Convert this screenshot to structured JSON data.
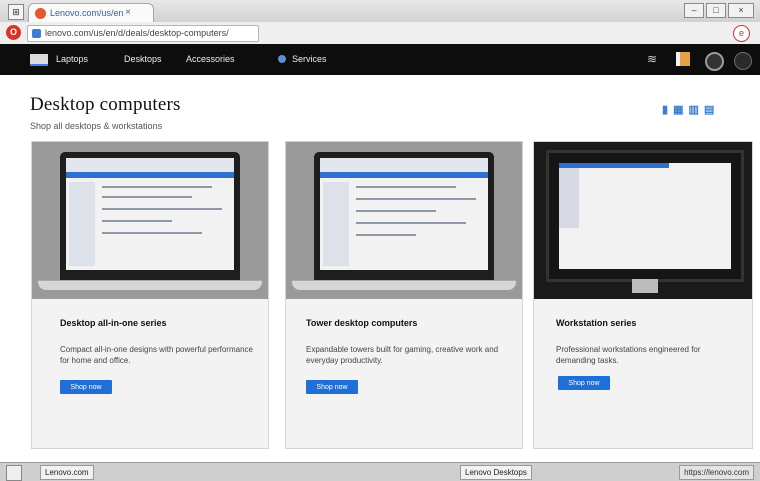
{
  "browser": {
    "tab_title": "Lenovo.com/us/en",
    "tab_close": "×",
    "window_square": "⊞",
    "controls": [
      "–",
      "□",
      "×"
    ],
    "url": "lenovo.com/us/en/d/deals/desktop-computers/",
    "opera_icon": "O",
    "ext_icon": "e"
  },
  "sitenav": {
    "items": [
      "Laptops",
      "Desktops",
      "Accessories",
      "Services"
    ]
  },
  "page": {
    "title": "Desktop computers",
    "subtitle": "Shop all desktops & workstations",
    "view_toggle": "▮ ▦ ▥ ▤"
  },
  "cards": [
    {
      "title": "Desktop all-in-one series",
      "desc": "Compact all-in-one designs with powerful performance for home and office.",
      "button": "Shop now"
    },
    {
      "title": "Tower desktop computers",
      "desc": "Expandable towers built for gaming, creative work and everyday productivity.",
      "button": "Shop now"
    },
    {
      "title": "Workstation series",
      "desc": "Professional workstations engineered for demanding tasks.",
      "button": "Shop now"
    }
  ],
  "taskbar": {
    "window_label": "Lenovo.com",
    "active_label": "Lenovo Desktops",
    "tray": "https://lenovo.com"
  },
  "colors": {
    "accent": "#1f6fd8",
    "nav": "#0d0d0d"
  }
}
